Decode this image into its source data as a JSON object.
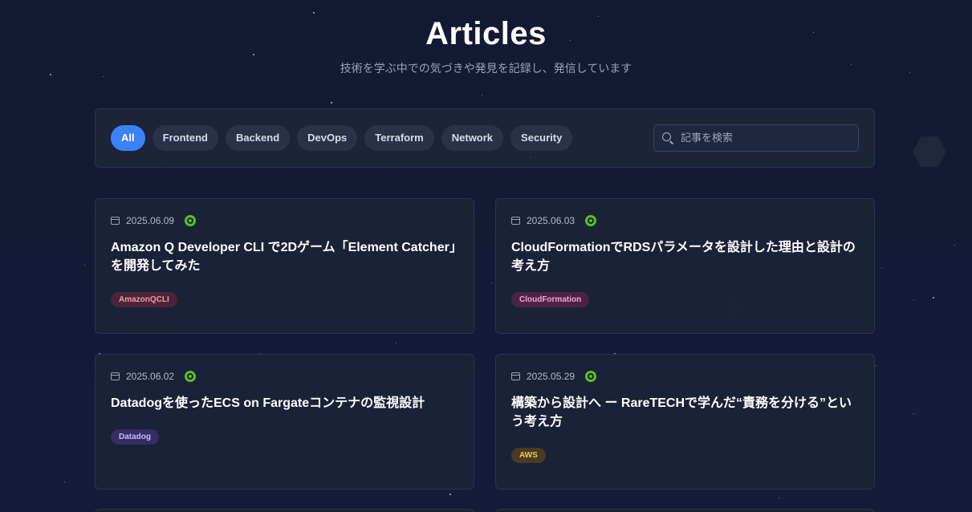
{
  "header": {
    "title": "Articles",
    "subtitle": "技術を学ぶ中での気づきや発見を記録し、発信しています"
  },
  "filters": {
    "categories": [
      "All",
      "Frontend",
      "Backend",
      "DevOps",
      "Terraform",
      "Network",
      "Security"
    ],
    "active": "All",
    "search_placeholder": "記事を検索"
  },
  "articles": [
    {
      "date": "2025.06.09",
      "source_icon": "qiita-icon",
      "title": "Amazon Q Developer CLI で2Dゲーム「Element Catcher」を開発してみた",
      "tag": "AmazonQCLI",
      "tag_color": "#f29aa8",
      "tag_bg": "#4a2438"
    },
    {
      "date": "2025.06.03",
      "source_icon": "qiita-icon",
      "title": "CloudFormationでRDSパラメータを設計した理由と設計の考え方",
      "tag": "CloudFormation",
      "tag_color": "#f4a3d6",
      "tag_bg": "#4b2346"
    },
    {
      "date": "2025.06.02",
      "source_icon": "qiita-icon",
      "title": "Datadogを使ったECS on Fargateコンテナの監視設計",
      "tag": "Datadog",
      "tag_color": "#c7b9ff",
      "tag_bg": "#352d63"
    },
    {
      "date": "2025.05.29",
      "source_icon": "qiita-icon",
      "title": "構築から設計へ ー RareTECHで学んだ“責務を分ける”という考え方",
      "tag": "AWS",
      "tag_color": "#f5c75a",
      "tag_bg": "#4a3a22"
    }
  ],
  "colors": {
    "accent": "#3b82f6",
    "background": "#141b36",
    "card": "#1b2338"
  }
}
